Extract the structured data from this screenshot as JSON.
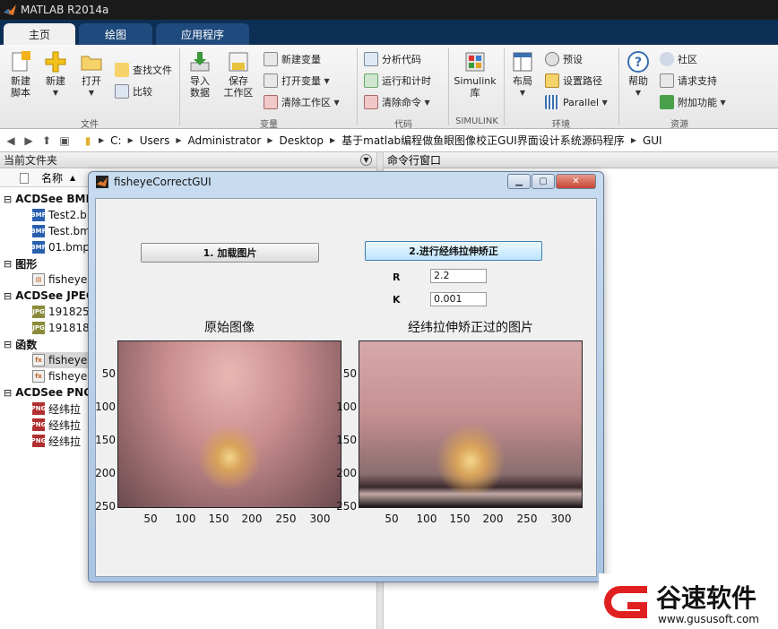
{
  "app": {
    "title": "MATLAB R2014a"
  },
  "tabs": [
    {
      "label": "主页",
      "active": true
    },
    {
      "label": "绘图",
      "active": false
    },
    {
      "label": "应用程序",
      "active": false
    }
  ],
  "ribbon": {
    "file": {
      "new_script": "新建\n脚本",
      "new": "新建",
      "open": "打开",
      "find_files": "查找文件",
      "compare": "比较",
      "group": "文件"
    },
    "variable": {
      "import": "导入\n数据",
      "save": "保存\n工作区",
      "new_var": "新建变量",
      "open_var": "打开变量",
      "clear_ws": "清除工作区",
      "group": "变量"
    },
    "code": {
      "analyze": "分析代码",
      "run_time": "运行和计时",
      "clear_cmd": "清除命令",
      "group": "代码"
    },
    "simulink": {
      "label": "Simulink\n库",
      "group": "SIMULINK"
    },
    "env": {
      "layout": "布局",
      "prefs": "预设",
      "set_path": "设置路径",
      "parallel": "Parallel",
      "group": "环境"
    },
    "resources": {
      "help": "帮助",
      "community": "社区",
      "request_support": "请求支持",
      "addons": "附加功能",
      "group": "资源"
    }
  },
  "address": {
    "crumbs": [
      "C:",
      "Users",
      "Administrator",
      "Desktop",
      "基于matlab编程做鱼眼图像校正GUI界面设计系统源码程序",
      "GUI"
    ]
  },
  "current_folder": {
    "title": "当前文件夹",
    "col_name": "名称",
    "rows": [
      {
        "label": "ACDSee BMP",
        "type": "group"
      },
      {
        "label": "Test2.b",
        "type": "bmp"
      },
      {
        "label": "Test.bm",
        "type": "bmp"
      },
      {
        "label": "01.bmp",
        "type": "bmp"
      },
      {
        "label": "图形",
        "type": "group"
      },
      {
        "label": "fisheye",
        "type": "fig"
      },
      {
        "label": "ACDSee JPEG",
        "type": "group"
      },
      {
        "label": "191825",
        "type": "jpg"
      },
      {
        "label": "191818",
        "type": "jpg"
      },
      {
        "label": "函数",
        "type": "group"
      },
      {
        "label": "fisheye",
        "type": "m",
        "selected": true
      },
      {
        "label": "fisheye",
        "type": "m"
      },
      {
        "label": "ACDSee PNG",
        "type": "group"
      },
      {
        "label": "经纬拉",
        "type": "png"
      },
      {
        "label": "经纬拉",
        "type": "png"
      },
      {
        "label": "经纬拉",
        "type": "png"
      }
    ]
  },
  "command_window": {
    "title": "命令行窗口"
  },
  "figure": {
    "title": "fisheyeCorrectGUI",
    "load_button": "1. 加载图片",
    "correct_button": "2.进行经纬拉伸矫正",
    "r_label": "R",
    "r_value": "2.2",
    "k_label": "K",
    "k_value": "0.001",
    "axes1_title": "原始图像",
    "axes2_title": "经纬拉伸矫正过的图片",
    "yticks": [
      "50",
      "100",
      "150",
      "200",
      "250"
    ],
    "xticks": [
      "50",
      "100",
      "150",
      "200",
      "250",
      "300"
    ]
  },
  "watermark": {
    "text": "谷速软件",
    "url": "www.gususoft.com"
  },
  "colors": {
    "tab_bar": "#0e2f55",
    "titlebar": "#1a1a1a",
    "watermark_red": "#e02020"
  }
}
